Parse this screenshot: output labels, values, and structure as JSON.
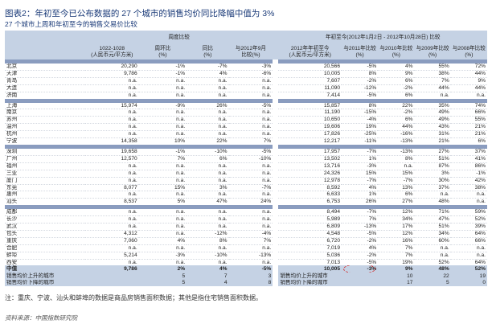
{
  "title": "图表2：年初至今已公布数据的 27 个城市的销售均价同比降幅中值为 3%",
  "subtitle": "27 个城市上周和年初至今的销售交易价比较",
  "header": {
    "group_week": "周度比较",
    "group_ytd": "年初至今(2012年1月2日 - 2012年10月28日) 比较",
    "col0": "",
    "col1": "1022-1028\n(人民币元/平方米)",
    "col2": "周环比\n(%)",
    "col3": "同比\n(%)",
    "col4": "与2012年9月\n比较(%)",
    "col5": "2012年年初至今\n(人民币元/平方米)",
    "col6": "与2011年比较\n(%)",
    "col7": "与2010年比较\n(%)",
    "col8": "与2009年比较\n(%)",
    "col9": "与2008年比较\n(%)"
  },
  "groups": [
    [
      [
        "北京",
        "20,290",
        "-1%",
        "-7%",
        "-3%",
        "20,566",
        "-5%",
        "4%",
        "55%",
        "72%"
      ],
      [
        "天津",
        "9,786",
        "-1%",
        "4%",
        "-6%",
        "10,005",
        "8%",
        "9%",
        "38%",
        "44%"
      ],
      [
        "青岛",
        "n.a.",
        "n.a.",
        "n.a.",
        "n.a.",
        "7,607",
        "-2%",
        "6%",
        "7%",
        "9%"
      ],
      [
        "大连",
        "n.a.",
        "n.a.",
        "n.a.",
        "n.a.",
        "11,090",
        "-12%",
        "-2%",
        "44%",
        "44%"
      ],
      [
        "济南",
        "n.a.",
        "n.a.",
        "n.a.",
        "n.a.",
        "7,414",
        "-5%",
        "6%",
        "n.a.",
        "n.a."
      ]
    ],
    [
      [
        "上海",
        "15,974",
        "-9%",
        "26%",
        "-5%",
        "15,857",
        "8%",
        "22%",
        "35%",
        "74%"
      ],
      [
        "南京",
        "n.a.",
        "n.a.",
        "n.a.",
        "n.a.",
        "11,190",
        "-15%",
        "-2%",
        "49%",
        "66%"
      ],
      [
        "苏州",
        "n.a.",
        "n.a.",
        "n.a.",
        "n.a.",
        "10,650",
        "-4%",
        "6%",
        "49%",
        "55%"
      ],
      [
        "温州",
        "n.a.",
        "n.a.",
        "n.a.",
        "n.a.",
        "19,606",
        "19%",
        "44%",
        "43%",
        "21%"
      ],
      [
        "杭州",
        "n.a.",
        "n.a.",
        "n.a.",
        "n.a.",
        "17,826",
        "-25%",
        "-16%",
        "31%",
        "21%"
      ],
      [
        "宁波",
        "14,358",
        "10%",
        "22%",
        "7%",
        "12,217",
        "-11%",
        "-13%",
        "21%",
        "6%"
      ]
    ],
    [
      [
        "深圳",
        "19,658",
        "-1%",
        "-10%",
        "-5%",
        "17,957",
        "-7%",
        "-13%",
        "27%",
        "37%"
      ],
      [
        "广州",
        "12,570",
        "7%",
        "6%",
        "-10%",
        "13,502",
        "1%",
        "8%",
        "51%",
        "41%"
      ],
      [
        "福州",
        "n.a.",
        "n.a.",
        "n.a.",
        "n.a.",
        "13,716",
        "-3%",
        "n.a.",
        "87%",
        "86%"
      ],
      [
        "三亚",
        "n.a.",
        "n.a.",
        "n.a.",
        "n.a.",
        "24,326",
        "15%",
        "15%",
        "3%",
        "-1%"
      ],
      [
        "厦门",
        "n.a.",
        "n.a.",
        "n.a.",
        "n.a.",
        "12,978",
        "-7%",
        "-7%",
        "30%",
        "42%"
      ],
      [
        "东莞",
        "8,077",
        "15%",
        "3%",
        "-7%",
        "8,592",
        "4%",
        "13%",
        "37%",
        "38%"
      ],
      [
        "惠州",
        "n.a.",
        "n.a.",
        "n.a.",
        "n.a.",
        "6,633",
        "1%",
        "6%",
        "n.a.",
        "n.a."
      ],
      [
        "汕头",
        "8,537",
        "5%",
        "47%",
        "24%",
        "6,753",
        "26%",
        "27%",
        "48%",
        "n.a."
      ]
    ],
    [
      [
        "成都",
        "n.a.",
        "n.a.",
        "n.a.",
        "n.a.",
        "8,494",
        "-7%",
        "12%",
        "71%",
        "59%"
      ],
      [
        "长沙",
        "n.a.",
        "n.a.",
        "n.a.",
        "n.a.",
        "5,989",
        "7%",
        "34%",
        "47%",
        "52%"
      ],
      [
        "武汉",
        "n.a.",
        "n.a.",
        "n.a.",
        "n.a.",
        "6,809",
        "-13%",
        "17%",
        "51%",
        "39%"
      ],
      [
        "包头",
        "4,312",
        "n.a.",
        "-12%",
        "-4%",
        "4,548",
        "-5%",
        "12%",
        "34%",
        "64%"
      ],
      [
        "重庆",
        "7,060",
        "4%",
        "8%",
        "7%",
        "6,720",
        "-2%",
        "16%",
        "60%",
        "66%"
      ],
      [
        "合肥",
        "n.a.",
        "n.a.",
        "n.a.",
        "n.a.",
        "7,019",
        "4%",
        "7%",
        "n.a.",
        "n.a."
      ],
      [
        "蚌埠",
        "5,214",
        "-3%",
        "-10%",
        "-13%",
        "5,036",
        "-2%",
        "7%",
        "n.a.",
        "n.a."
      ],
      [
        "西安",
        "n.a.",
        "n.a.",
        "n.a.",
        "n.a.",
        "7,013",
        "-5%",
        "19%",
        "52%",
        "64%"
      ]
    ]
  ],
  "avg_row": [
    "中值",
    "9,786",
    "2%",
    "4%",
    "-5%",
    "10,005",
    "-3%",
    "9%",
    "48%",
    "52%"
  ],
  "count_rows": [
    [
      "销售均价上升的城市",
      "5",
      "7",
      "3",
      "销售均价上升的城市",
      "10",
      "22",
      "19"
    ],
    [
      "销售均价下降的城市",
      "5",
      "4",
      "8",
      "销售均价下降的城市",
      "17",
      "5",
      "0"
    ]
  ],
  "note": "注：重庆、宁波、汕头和蚌埠的数据是商品房销售面积数据；其他是指住宅销售面积数据。",
  "source": "资料来源：中国指数研究院"
}
